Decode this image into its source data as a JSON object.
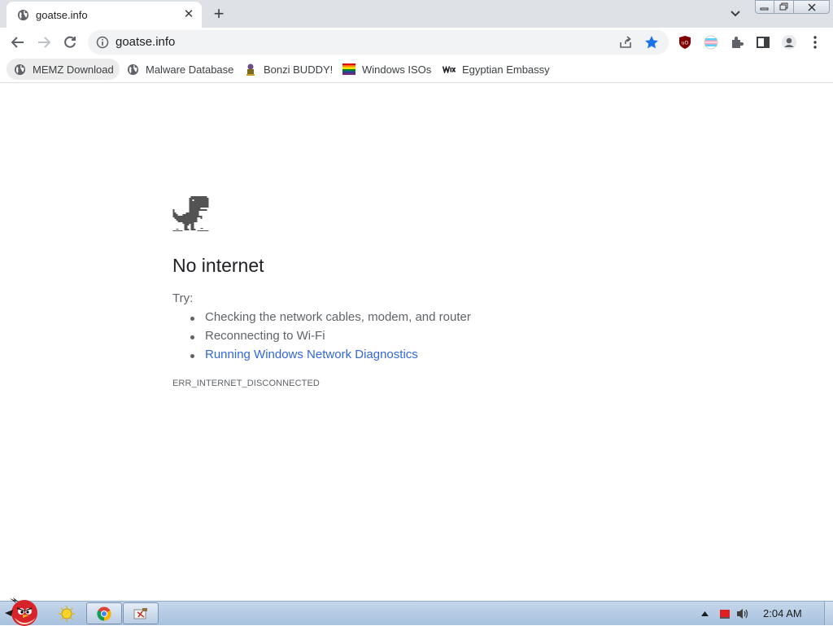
{
  "tab": {
    "title": "goatse.info",
    "close_glyph": "✕"
  },
  "newtab_glyph": "+",
  "omnibox": {
    "url": "goatse.info"
  },
  "bookmarks": [
    {
      "label": "MEMZ Download",
      "icon": "globe-icon"
    },
    {
      "label": "Malware Database",
      "icon": "globe-icon"
    },
    {
      "label": "Bonzi BUDDY!",
      "icon": "bonzi-icon"
    },
    {
      "label": "Windows ISOs",
      "icon": "rainbow-flag-icon"
    },
    {
      "label": "Egyptian Embassy",
      "icon": "wix-icon"
    }
  ],
  "error_page": {
    "heading": "No internet",
    "try_label": "Try:",
    "suggestions": [
      "Checking the network cables, modem, and router",
      "Reconnecting to Wi-Fi",
      "Running Windows Network Diagnostics"
    ],
    "error_code": "ERR_INTERNET_DISCONNECTED"
  },
  "taskbar": {
    "clock": "2:04 AM"
  },
  "colors": {
    "accent_star": "#1a73e8",
    "link": "#3367d6",
    "tabstrip": "#dee1e6"
  }
}
